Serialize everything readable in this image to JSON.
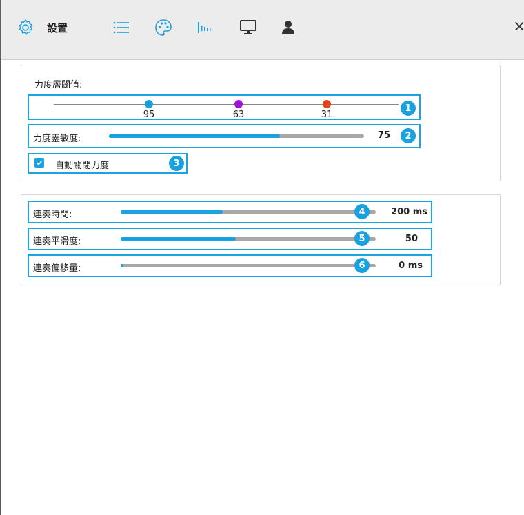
{
  "toolbar": {
    "title": "設置",
    "icons": [
      "gear-icon",
      "list-icon",
      "palette-icon",
      "bars-icon",
      "monitor-icon",
      "user-icon"
    ],
    "active_icon": "palette-icon",
    "close_label": "×"
  },
  "velocity": {
    "threshold_label": "力度層閾值:",
    "thresholds": [
      {
        "value": "95",
        "color": "#1aa1e0"
      },
      {
        "value": "63",
        "color": "#a012d6"
      },
      {
        "value": "31",
        "color": "#e0461a"
      }
    ],
    "sensitivity_label": "力度靈敏度:",
    "sensitivity_value": "75",
    "sensitivity_fraction": 0.67,
    "auto_close_label": "自動關閉力度",
    "auto_close_checked": true
  },
  "strum": {
    "time_label": "連奏時間:",
    "time_value": "200 ms",
    "time_fraction": 0.4,
    "smooth_label": "連奏平滑度:",
    "smooth_value": "50",
    "smooth_fraction": 0.45,
    "offset_label": "連奏偏移量:",
    "offset_value": "0 ms",
    "offset_fraction": 0.01
  },
  "badges": [
    "1",
    "2",
    "3",
    "4",
    "5",
    "6"
  ],
  "colors": {
    "accent": "#1aa1e0",
    "highlight": "#19a3e0",
    "track": "#a8a8a8"
  }
}
